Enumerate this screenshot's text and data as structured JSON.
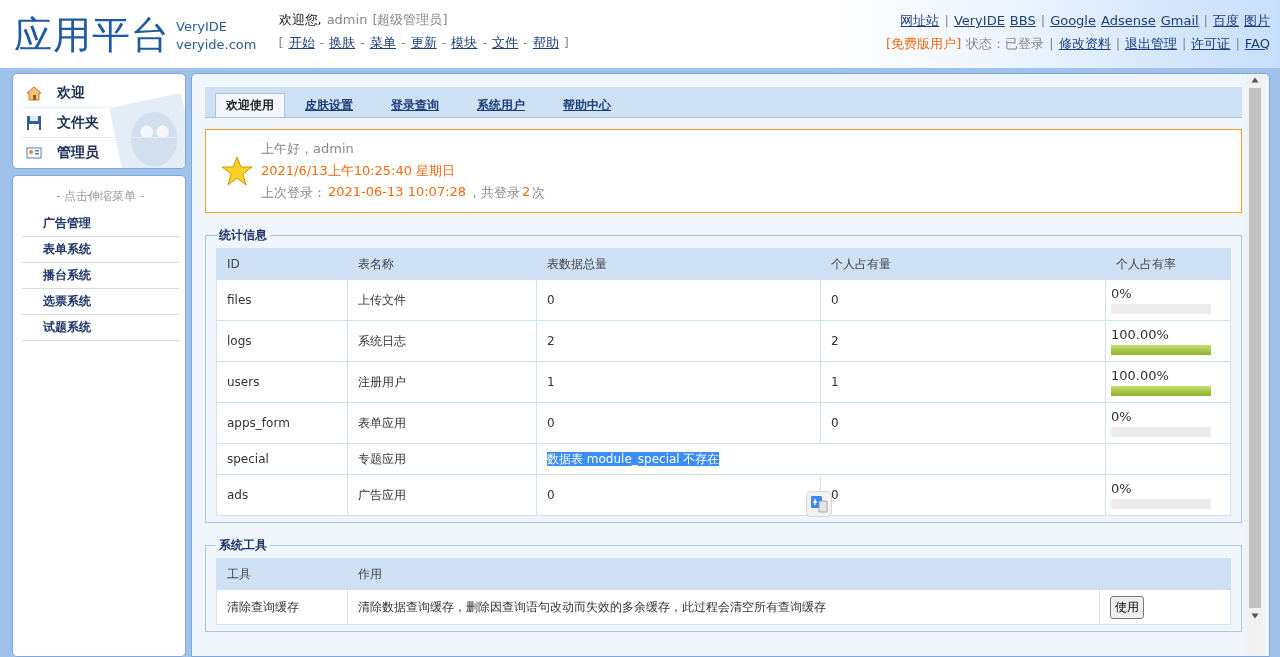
{
  "header": {
    "logo": "应用平台",
    "brand": "VeryIDE",
    "domain": "veryide.com",
    "welcome": "欢迎您,",
    "user": "admin",
    "role": "[超级管理员]",
    "nav_open": "[",
    "nav_close": "]",
    "nav": [
      {
        "label": "开始"
      },
      {
        "label": "换肤",
        "separator": "-"
      },
      {
        "label": "菜单",
        "separator": "-"
      },
      {
        "label": "更新",
        "separator": "-"
      },
      {
        "label": "模块",
        "separator": "-"
      },
      {
        "label": "文件",
        "separator": "-"
      },
      {
        "label": "帮助",
        "separator": "-"
      }
    ],
    "links": [
      {
        "label": "网址站"
      },
      {
        "label": "VeryIDE",
        "separator": "|"
      },
      {
        "label": "BBS"
      },
      {
        "label": "Google",
        "separator": "|"
      },
      {
        "label": "Adsense"
      },
      {
        "label": "Gmail"
      },
      {
        "label": "百度",
        "separator": "|"
      },
      {
        "label": "图片"
      }
    ],
    "edition": "[免费版用户]",
    "status": "状态：已登录",
    "account_links": [
      {
        "label": "修改资料",
        "separator": "|"
      },
      {
        "label": "退出管理",
        "separator": "|"
      },
      {
        "label": "许可证",
        "separator": "|"
      },
      {
        "label": "FAQ",
        "separator": "|"
      }
    ]
  },
  "sidebar": {
    "shortcuts": [
      {
        "label": "欢迎",
        "kind": "house"
      },
      {
        "label": "文件夹",
        "kind": "floppy"
      },
      {
        "label": "管理员",
        "kind": "card"
      }
    ],
    "menu_title": "- 点击伸缩菜单 -",
    "menu": [
      "广告管理",
      "表单系统",
      "播台系统",
      "选票系统",
      "试题系统"
    ]
  },
  "tabs": [
    {
      "label": "欢迎使用",
      "selected": true
    },
    {
      "label": "皮肤设置",
      "selected": false
    },
    {
      "label": "登录查询",
      "selected": false
    },
    {
      "label": "系统用户",
      "selected": false
    },
    {
      "label": "帮助中心",
      "selected": false
    }
  ],
  "welcome": {
    "greeting": "上午好，admin",
    "datetime": "2021/6/13上午10:25:40 星期日",
    "last_login_label": "上次登录：",
    "last_login_time": "2021-06-13 10:07:28",
    "count_label": "，共登录",
    "count": "2",
    "count_unit": "次"
  },
  "stats": {
    "legend": "统计信息",
    "columns": [
      "ID",
      "表名称",
      "表数据总量",
      "个人占有量",
      "个人占有率"
    ],
    "rows": [
      {
        "kind": "data",
        "id": "files",
        "name": "上传文件",
        "total": "0",
        "own": "0",
        "rate": "0%"
      },
      {
        "kind": "data",
        "id": "logs",
        "name": "系统日志",
        "total": "2",
        "own": "2",
        "rate": "100.00%",
        "level": 1
      },
      {
        "kind": "data",
        "id": "users",
        "name": "注册用户",
        "total": "1",
        "own": "1",
        "rate": "100.00%",
        "level": 1
      },
      {
        "kind": "data",
        "id": "apps_form",
        "name": "表单应用",
        "total": "0",
        "own": "0",
        "rate": "0%"
      },
      {
        "kind": "missing",
        "id": "special",
        "name": "专题应用",
        "message": "数据表 module_special 不存在",
        "highlighted": true
      },
      {
        "kind": "data",
        "id": "ads",
        "name": "广告应用",
        "total": "0",
        "own": "0",
        "rate": "0%"
      }
    ]
  },
  "tools": {
    "legend": "系统工具",
    "columns": [
      "工具",
      "作用"
    ],
    "rows": [
      {
        "tool": "清除查询缓存",
        "description": "清除数据查询缓存，删除因查询语句改动而失效的多余缓存，此过程会清空所有查询缓存",
        "button": "使用"
      }
    ]
  }
}
